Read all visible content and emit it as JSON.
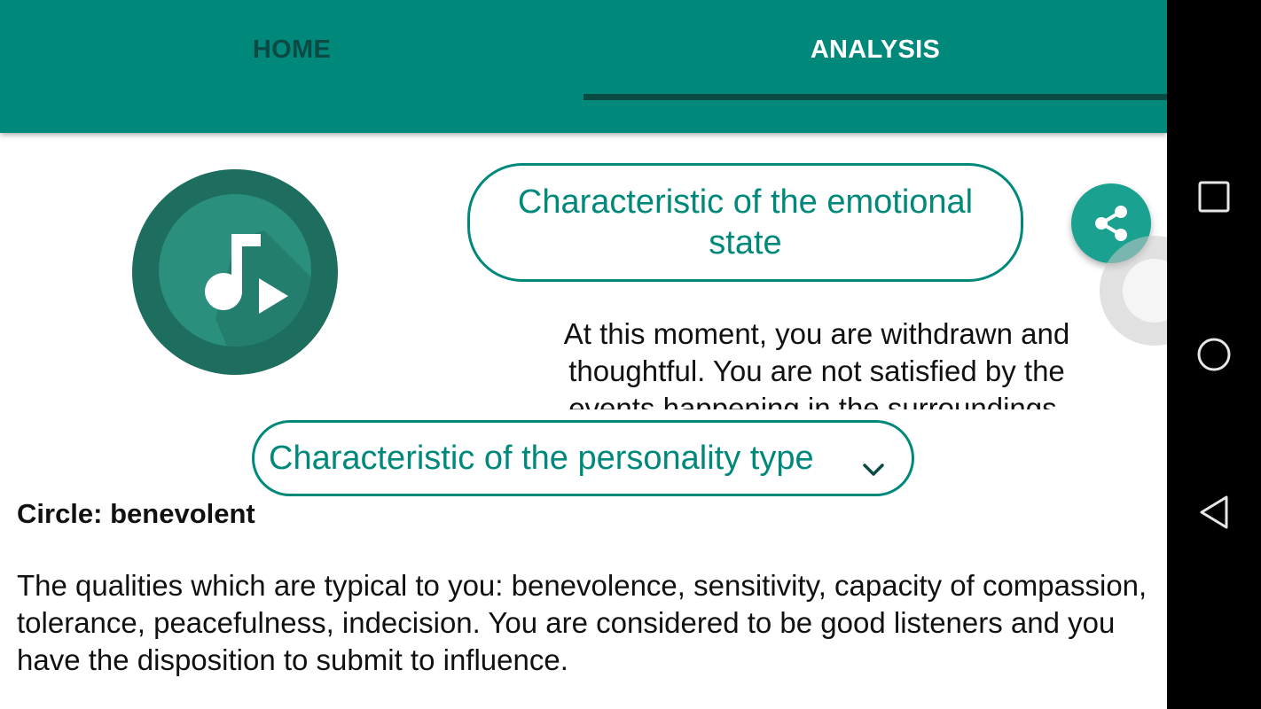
{
  "tabs": [
    {
      "label": "HOME",
      "selected": false
    },
    {
      "label": "ANALYSIS",
      "selected": true
    }
  ],
  "colors": {
    "accent": "#00897B",
    "indicator": "#0c4a44",
    "fab": "#1aa190"
  },
  "logo": {
    "icon": "music-note-play-icon"
  },
  "emotional": {
    "title": "Characteristic of the emotional state",
    "text": "At this moment, you are withdrawn and thoughtful. You are not satisfied by the events happening in the surroundings."
  },
  "share_button": {
    "icon": "share-icon"
  },
  "personality": {
    "title": "Characteristic of the personality type",
    "icon": "chevron-down-icon",
    "circle": "Circle: benevolent",
    "qualities": "The qualities which are typical to you: benevolence, sensitivity, capacity of compassion, tolerance, peacefulness, indecision. You are considered to be good listeners and you have the disposition to submit to influence."
  },
  "navigation": {
    "recents_icon": "square-icon",
    "home_icon": "circle-icon",
    "back_icon": "triangle-back-icon"
  }
}
